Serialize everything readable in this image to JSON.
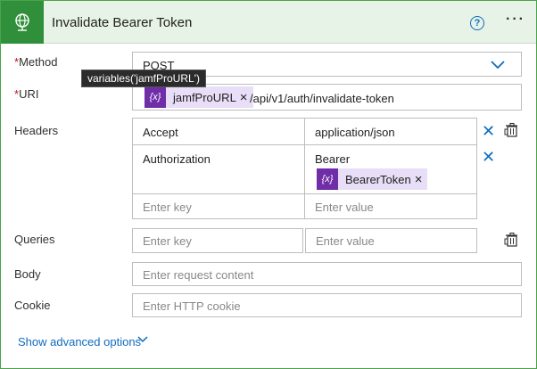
{
  "header": {
    "title": "Invalidate Bearer Token",
    "help_glyph": "?",
    "more_glyph": "···"
  },
  "tooltip": "variables('jamfProURL')",
  "method": {
    "required_mark": "*",
    "label": "Method",
    "value": "POST"
  },
  "uri": {
    "required_mark": "*",
    "label": "URI",
    "chip_label": "jamfProURL",
    "chip_icon_text": "{x}",
    "suffix": "/api/v1/auth/invalidate-token"
  },
  "headers": {
    "label": "Headers",
    "rows": [
      {
        "key": "Accept",
        "value": "application/json"
      },
      {
        "key": "Authorization",
        "value": "Bearer",
        "value_chip": "BearerToken"
      }
    ],
    "key_placeholder": "Enter key",
    "value_placeholder": "Enter value"
  },
  "queries": {
    "label": "Queries",
    "key_placeholder": "Enter key",
    "value_placeholder": "Enter value"
  },
  "body": {
    "label": "Body",
    "placeholder": "Enter request content"
  },
  "cookie": {
    "label": "Cookie",
    "placeholder": "Enter HTTP cookie"
  },
  "advanced": {
    "label": "Show advanced options"
  },
  "colors": {
    "accent": "#0f6cbd",
    "header_bg": "#e6f3e6",
    "icon_bg": "#2f8f3a",
    "chip_bg": "#e8def8",
    "chip_icon_bg": "#6f2da8",
    "required": "#c50f1f"
  },
  "icons": {
    "action": "globe-icon",
    "help": "help-circle-icon",
    "more": "more-options-icon",
    "dropdown": "chevron-down-icon",
    "variable": "variable-icon",
    "remove": "close-icon",
    "delete": "trash-icon"
  }
}
